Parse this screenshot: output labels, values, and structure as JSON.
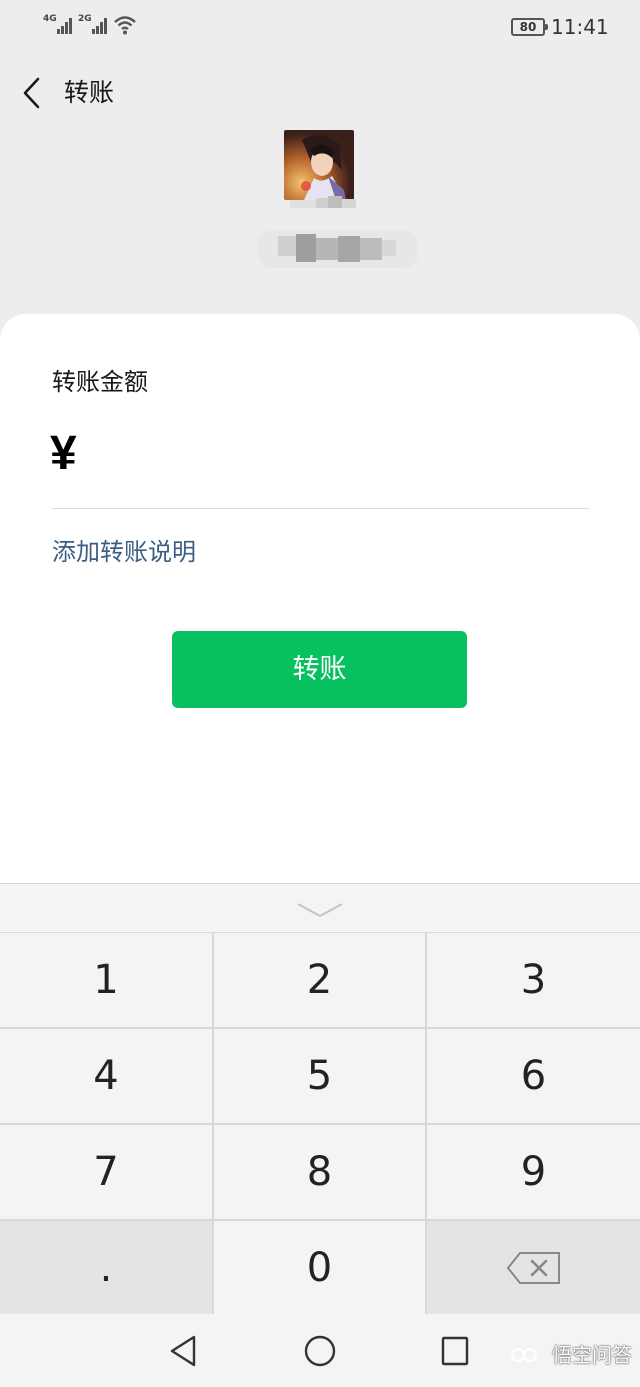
{
  "status_bar": {
    "sim1_net": "4G",
    "sim2_net": "2G",
    "battery": "80",
    "time": "11:41"
  },
  "header": {
    "title": "转账"
  },
  "form": {
    "amount_label": "转账金额",
    "currency_symbol": "¥",
    "amount_value": "",
    "add_note": "添加转账说明",
    "submit": "转账"
  },
  "keypad": {
    "keys": [
      "1",
      "2",
      "3",
      "4",
      "5",
      "6",
      "7",
      "8",
      "9",
      ".",
      "0"
    ],
    "collapse_icon": "chevron-down-icon",
    "delete_icon": "backspace-icon"
  },
  "nav": {
    "back_icon": "triangle-back-icon",
    "home_icon": "circle-home-icon",
    "recent_icon": "square-recent-icon"
  },
  "watermark": {
    "text": "悟空问答"
  },
  "colors": {
    "primary_green": "#07c160",
    "link_blue": "#3a5e85",
    "page_bg": "#ededed"
  }
}
